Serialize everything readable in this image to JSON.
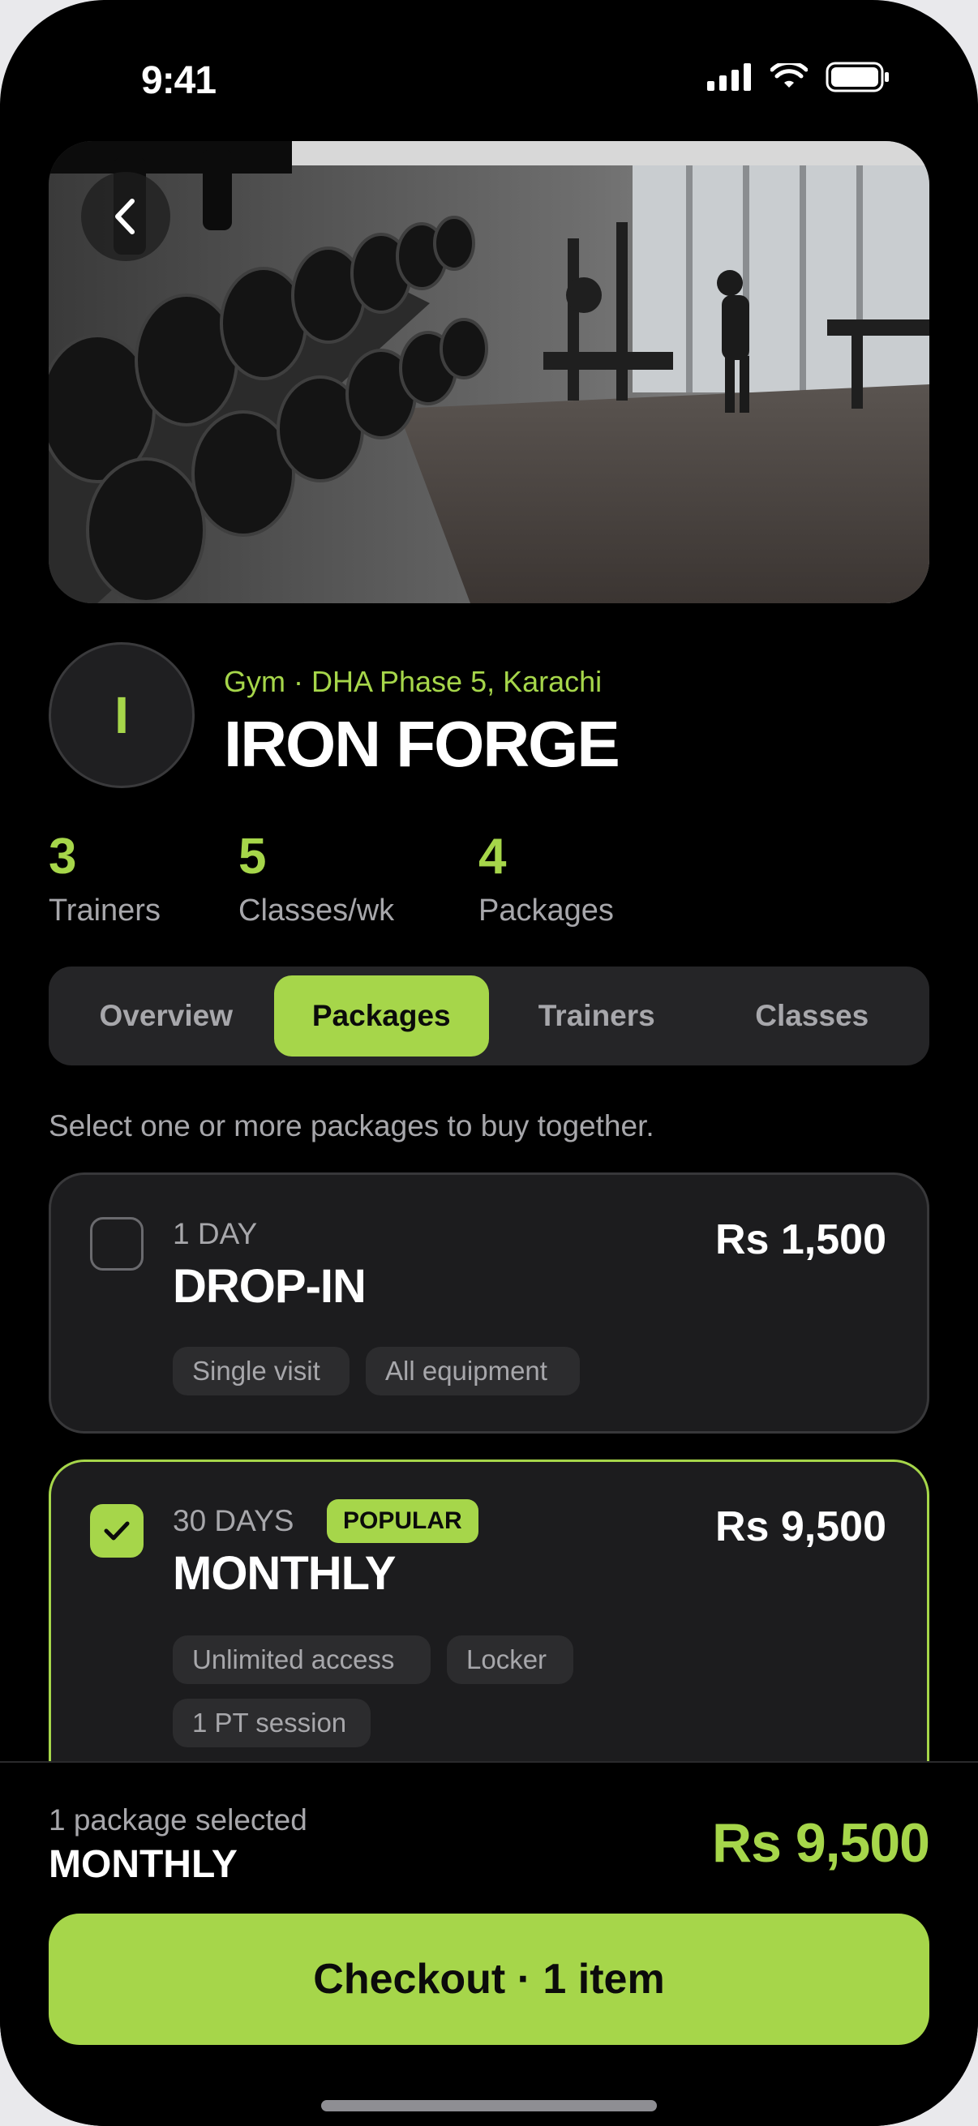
{
  "status": {
    "time": "9:41"
  },
  "hero": {
    "image": "gym-dumbbell-rack-photo"
  },
  "gym": {
    "initial": "I",
    "subtitle": "Gym · DHA Phase 5, Karachi",
    "name": "IRON FORGE"
  },
  "stats": [
    {
      "value": "3",
      "label": "Trainers"
    },
    {
      "value": "5",
      "label": "Classes/wk"
    },
    {
      "value": "4",
      "label": "Packages"
    }
  ],
  "tabs": [
    {
      "label": "Overview",
      "active": false
    },
    {
      "label": "Packages",
      "active": true
    },
    {
      "label": "Trainers",
      "active": false
    },
    {
      "label": "Classes",
      "active": false
    }
  ],
  "helper_text": "Select one or more packages to buy together.",
  "packages": [
    {
      "duration": "1 DAY",
      "name": "DROP-IN",
      "price": "Rs 1,500",
      "selected": false,
      "features": [
        "Single visit",
        "All equipment"
      ]
    },
    {
      "duration": "30 DAYS",
      "badge": "POPULAR",
      "name": "MONTHLY",
      "price": "Rs 9,500",
      "selected": true,
      "features": [
        "Unlimited access",
        "Locker",
        "1 PT session"
      ]
    }
  ],
  "summary": {
    "count_text": "1 package selected",
    "selected_name": "MONTHLY",
    "total": "Rs 9,500",
    "checkout_label": "Checkout · 1 item"
  },
  "colors": {
    "accent": "#a6d64a",
    "background": "#000000",
    "card": "#1c1c1e"
  }
}
